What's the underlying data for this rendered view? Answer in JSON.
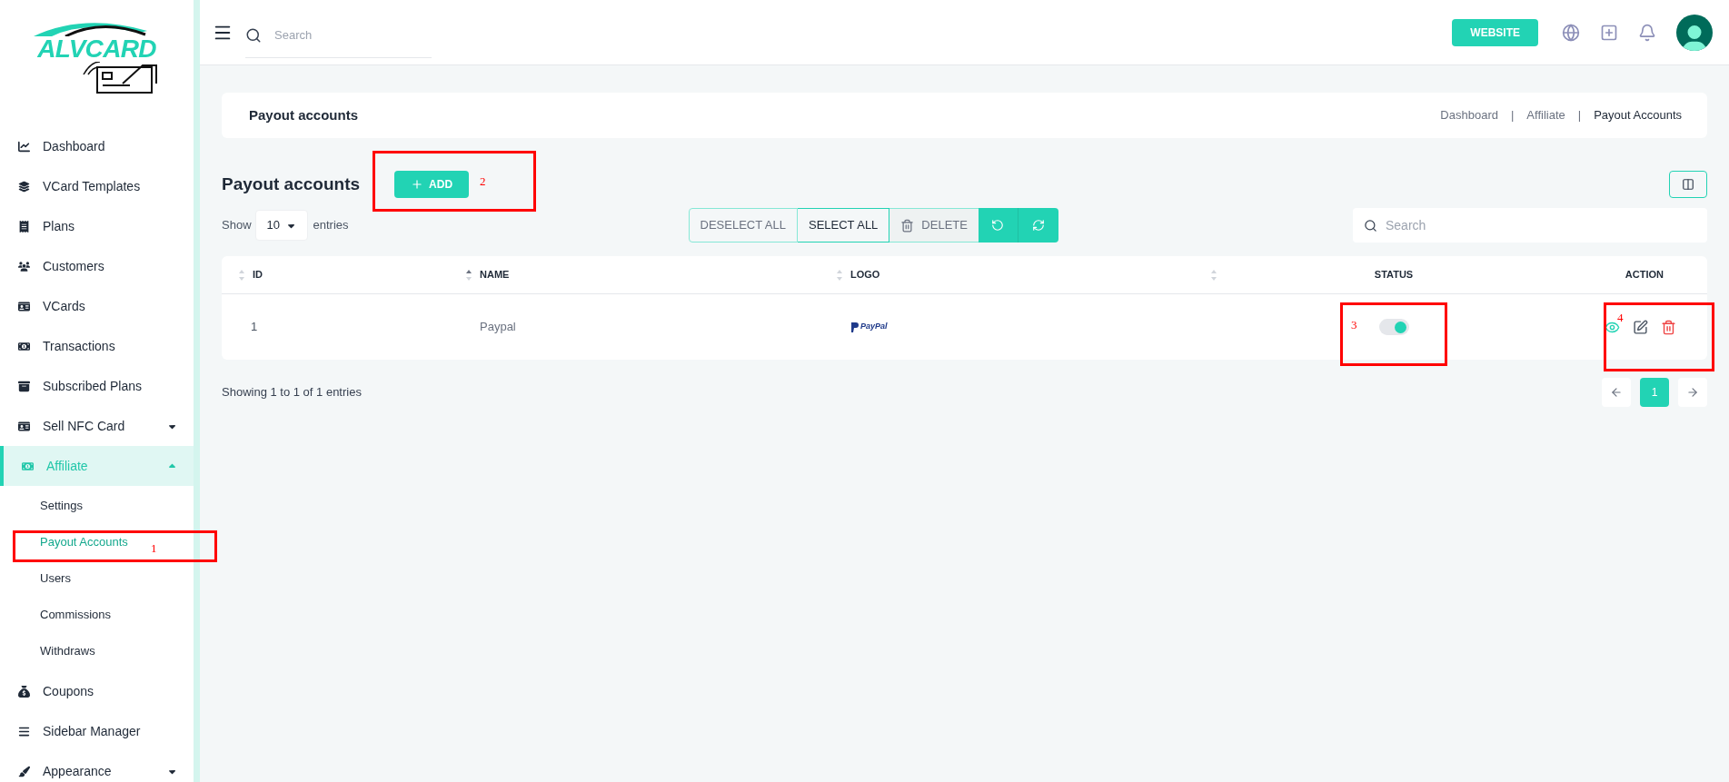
{
  "logo_text": "ALVCARD",
  "sidebar": {
    "items": [
      {
        "label": "Dashboard",
        "kind": "link",
        "selected": false
      },
      {
        "label": "VCard Templates",
        "kind": "link",
        "selected": false
      },
      {
        "label": "Plans",
        "kind": "link",
        "selected": false
      },
      {
        "label": "Customers",
        "kind": "link",
        "selected": false
      },
      {
        "label": "VCards",
        "kind": "link",
        "selected": false
      },
      {
        "label": "Transactions",
        "kind": "link",
        "selected": false
      },
      {
        "label": "Subscribed Plans",
        "kind": "link",
        "selected": false
      },
      {
        "label": "Sell NFC Card",
        "kind": "group",
        "selected": false,
        "expanded": false
      },
      {
        "label": "Affiliate",
        "kind": "group",
        "selected": true,
        "expanded": true,
        "children": [
          {
            "label": "Settings",
            "selected": false
          },
          {
            "label": "Payout Accounts",
            "selected": true
          },
          {
            "label": "Users",
            "selected": false
          },
          {
            "label": "Commissions",
            "selected": false
          },
          {
            "label": "Withdraws",
            "selected": false
          }
        ]
      },
      {
        "label": "Coupons",
        "kind": "link",
        "selected": false
      },
      {
        "label": "Sidebar Manager",
        "kind": "link",
        "selected": false
      },
      {
        "label": "Appearance",
        "kind": "group",
        "selected": false,
        "expanded": false
      }
    ]
  },
  "header": {
    "search": {
      "placeholder": "Search"
    },
    "website_button": "WEBSITE"
  },
  "page_header": {
    "title": "Payout accounts",
    "separator": "|",
    "breadcrumb": [
      {
        "label": "Dashboard",
        "selected": false
      },
      {
        "label": "Affiliate",
        "selected": false
      },
      {
        "label": "Payout Accounts",
        "selected": true
      }
    ]
  },
  "section": {
    "title": "Payout accounts",
    "add_button": "ADD"
  },
  "toolbar": {
    "show_label": "Show",
    "entries_value": "10",
    "entries_label": "entries",
    "deselect_all": "DESELECT ALL",
    "select_all": "SELECT ALL",
    "delete": "DELETE",
    "search": {
      "placeholder": "Search"
    }
  },
  "table": {
    "columns": [
      {
        "label": "ID",
        "sorted": false
      },
      {
        "label": "NAME",
        "sorted": true
      },
      {
        "label": "LOGO",
        "sorted": false
      },
      {
        "sorted": false
      },
      {
        "label": "STATUS"
      },
      {
        "label": "ACTION"
      }
    ],
    "rows": [
      {
        "id": "1",
        "name": "Paypal",
        "logo_text": "PayPal",
        "status_on": true
      }
    ]
  },
  "footer": {
    "summary": "Showing 1 to 1 of 1 entries",
    "pages": [
      {
        "label": "1",
        "selected": true
      }
    ]
  },
  "annotations": [
    {
      "label": "1"
    },
    {
      "label": "2"
    },
    {
      "label": "3"
    },
    {
      "label": "4"
    }
  ]
}
